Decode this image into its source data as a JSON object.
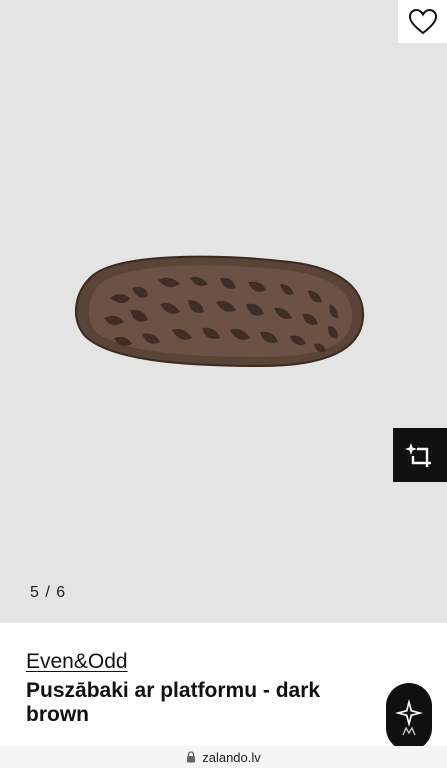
{
  "gallery": {
    "counter": "5 / 6",
    "favorite_icon": "heart-outline-icon",
    "tryon_icon": "sparkle-crop-icon"
  },
  "product": {
    "brand": "Even&Odd",
    "title": "Puszābaki ar platformu - dark brown"
  },
  "assistant": {
    "icon": "sparkle-logo-icon"
  },
  "browser": {
    "url": "zalando.lv",
    "lock_icon": "lock-icon"
  },
  "colors": {
    "gallery_bg": "#e4e4e4",
    "sole": "#5a4438",
    "sole_dark": "#3f2e26",
    "button_dark": "#111111"
  }
}
